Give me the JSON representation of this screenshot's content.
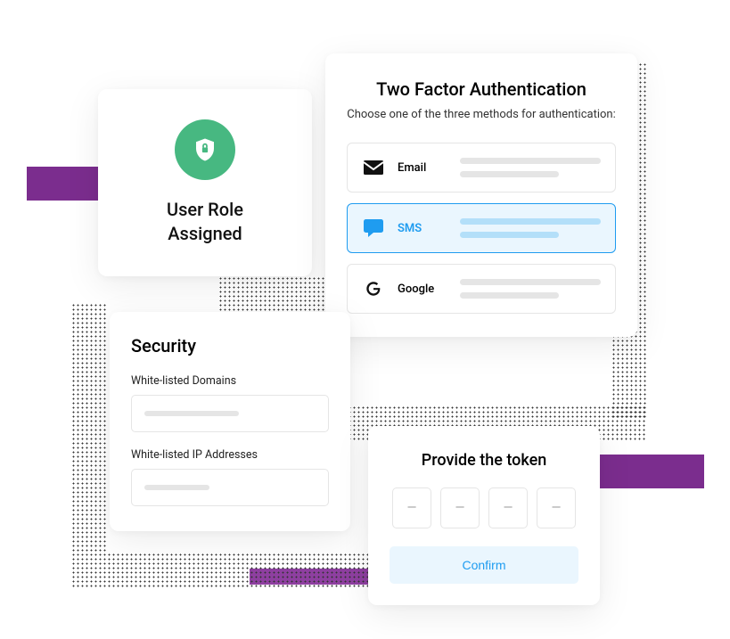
{
  "role_card": {
    "title": "User Role\nAssigned",
    "icon": "shield-lock-icon"
  },
  "two_factor": {
    "title": "Two Factor Authentication",
    "subtitle": "Choose one of the three methods for authentication:",
    "methods": [
      {
        "id": "email",
        "label": "Email",
        "icon": "email-icon",
        "active": false
      },
      {
        "id": "sms",
        "label": "SMS",
        "icon": "sms-icon",
        "active": true
      },
      {
        "id": "google",
        "label": "Google",
        "icon": "google-icon",
        "active": false
      }
    ]
  },
  "security": {
    "title": "Security",
    "fields": [
      {
        "label": "White-listed Domains"
      },
      {
        "label": "White-listed IP Addresses"
      }
    ]
  },
  "token": {
    "title": "Provide the token",
    "slots": [
      "—",
      "—",
      "—",
      "—"
    ],
    "confirm_label": "Confirm"
  },
  "colors": {
    "accent_green": "#47b881",
    "accent_blue": "#1f9cf0",
    "accent_purple": "#7b2d8e"
  }
}
